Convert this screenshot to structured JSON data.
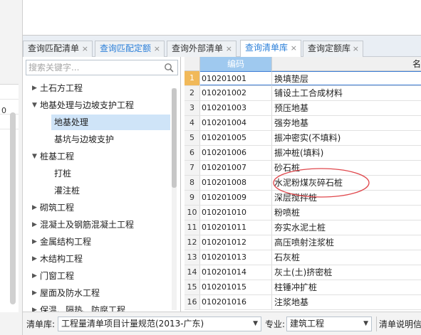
{
  "left_strip": {
    "text": "0"
  },
  "tabs": [
    {
      "label": "查询匹配清单",
      "color": "#333333",
      "active": false
    },
    {
      "label": "查询匹配定额",
      "color": "#2b7fd9",
      "active": false
    },
    {
      "label": "查询外部清单",
      "color": "#333333",
      "active": false
    },
    {
      "label": "查询清单库",
      "color": "#2b7fd9",
      "active": true
    },
    {
      "label": "查询定额库",
      "color": "#333333",
      "active": false
    }
  ],
  "tab_close_glyph": "×",
  "search": {
    "placeholder": "搜索关键字...",
    "icon": "search-icon"
  },
  "tree": {
    "items": [
      {
        "label": "土石方工程",
        "expanded": false,
        "level": 0
      },
      {
        "label": "地基处理与边坡支护工程",
        "expanded": true,
        "level": 0
      },
      {
        "label": "地基处理",
        "level": 1,
        "selected": true
      },
      {
        "label": "基坑与边坡支护",
        "level": 1
      },
      {
        "label": "桩基工程",
        "expanded": true,
        "level": 0
      },
      {
        "label": "打桩",
        "level": 1
      },
      {
        "label": "灌注桩",
        "level": 1
      },
      {
        "label": "砌筑工程",
        "expanded": false,
        "level": 0
      },
      {
        "label": "混凝土及钢筋混凝土工程",
        "expanded": false,
        "level": 0
      },
      {
        "label": "金属结构工程",
        "expanded": false,
        "level": 0
      },
      {
        "label": "木结构工程",
        "expanded": false,
        "level": 0
      },
      {
        "label": "门窗工程",
        "expanded": false,
        "level": 0
      },
      {
        "label": "屋面及防水工程",
        "expanded": false,
        "level": 0
      },
      {
        "label": "保温、隔热、防腐工程",
        "expanded": false,
        "level": 0
      }
    ]
  },
  "grid": {
    "headers": {
      "code": "编码",
      "name": "名"
    },
    "rows": [
      {
        "no": "1",
        "code": "010201001",
        "name": "换填垫层"
      },
      {
        "no": "2",
        "code": "010201002",
        "name": "铺设土工合成材料"
      },
      {
        "no": "3",
        "code": "010201003",
        "name": "预压地基"
      },
      {
        "no": "4",
        "code": "010201004",
        "name": "强夯地基"
      },
      {
        "no": "5",
        "code": "010201005",
        "name": "振冲密实(不填料)"
      },
      {
        "no": "6",
        "code": "010201006",
        "name": "振冲桩(填料)"
      },
      {
        "no": "7",
        "code": "010201007",
        "name": "砂石桩"
      },
      {
        "no": "8",
        "code": "010201008",
        "name": "水泥粉煤灰碎石桩"
      },
      {
        "no": "9",
        "code": "010201009",
        "name": "深层搅拌桩"
      },
      {
        "no": "10",
        "code": "010201010",
        "name": "粉喷桩"
      },
      {
        "no": "11",
        "code": "010201011",
        "name": "夯实水泥土桩"
      },
      {
        "no": "12",
        "code": "010201012",
        "name": "高压喷射注浆桩"
      },
      {
        "no": "13",
        "code": "010201013",
        "name": "石灰桩"
      },
      {
        "no": "14",
        "code": "010201014",
        "name": "灰土(土)挤密桩"
      },
      {
        "no": "15",
        "code": "010201015",
        "name": "柱锤冲扩桩"
      },
      {
        "no": "16",
        "code": "010201016",
        "name": "注浆地基"
      }
    ],
    "annotation_color": "#e0474c"
  },
  "bottom": {
    "library_label": "清单库:",
    "library_value": "工程量清单项目计量规范(2013-广东)",
    "major_label": "专业:",
    "major_value": "建筑工程",
    "help_label": "清单说明信"
  }
}
